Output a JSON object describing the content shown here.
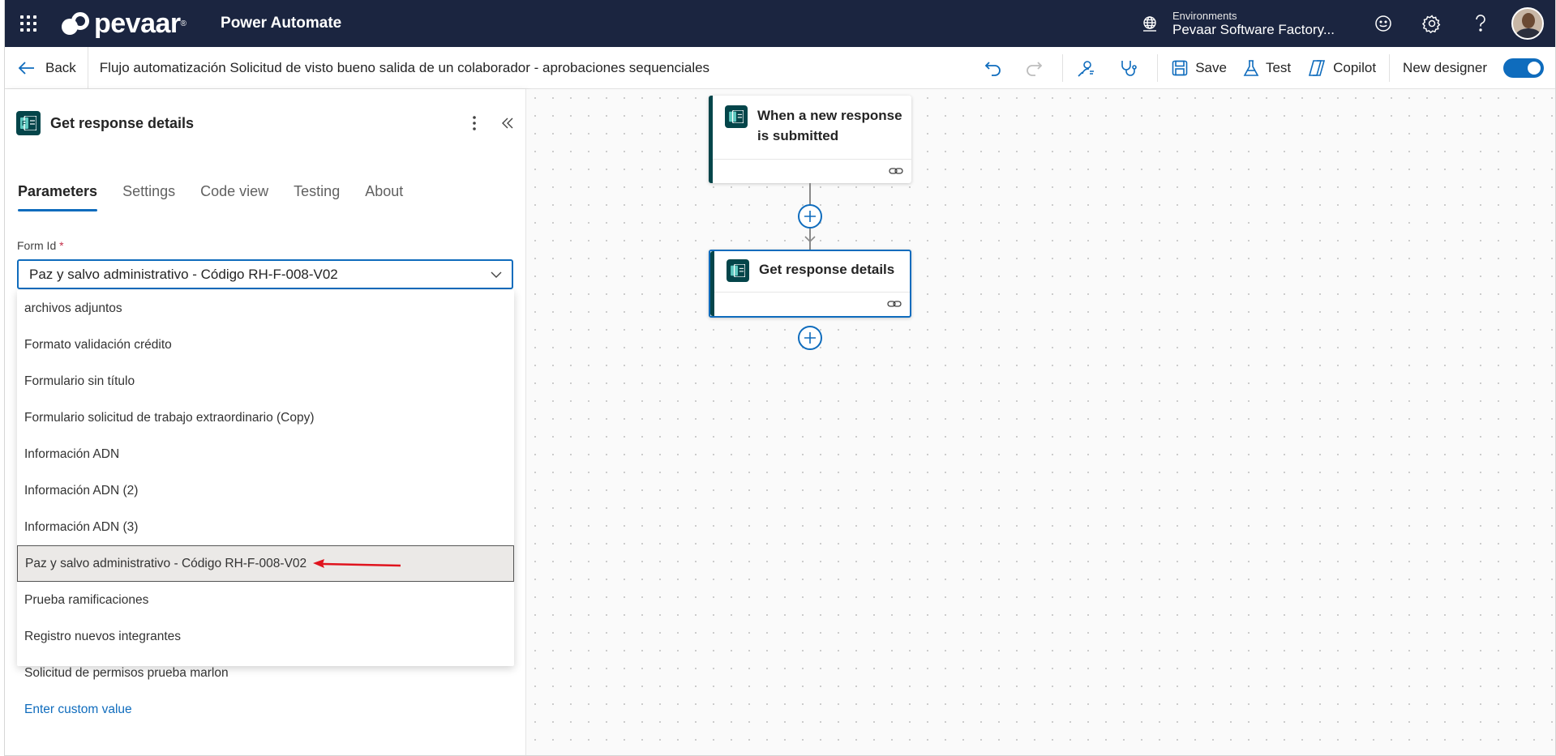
{
  "topbar": {
    "brand_name": "pevaar",
    "brand_reg": "®",
    "app_title": "Power Automate",
    "environment_label": "Environments",
    "environment_name": "Pevaar Software Factory..."
  },
  "cmdbar": {
    "back_label": "Back",
    "flow_title": "Flujo automatización Solicitud de visto bueno salida de un colaborador - aprobaciones sequenciales",
    "save_label": "Save",
    "test_label": "Test",
    "copilot_label": "Copilot",
    "new_designer_label": "New designer",
    "new_designer_on": true
  },
  "panel": {
    "title": "Get response details",
    "tabs": [
      {
        "label": "Parameters",
        "active": true
      },
      {
        "label": "Settings",
        "active": false
      },
      {
        "label": "Code view",
        "active": false
      },
      {
        "label": "Testing",
        "active": false
      },
      {
        "label": "About",
        "active": false
      }
    ],
    "field_label": "Form Id",
    "required_mark": "*",
    "field_value": "Paz y salvo administrativo - Código RH-F-008-V02",
    "options": [
      "archivos adjuntos",
      "Formato validación crédito",
      "Formulario sin título",
      "Formulario solicitud de trabajo extraordinario (Copy)",
      "Información ADN",
      "Información ADN (2)",
      "Información ADN (3)",
      "Paz y salvo administrativo - Código RH-F-008-V02",
      "Prueba ramificaciones",
      "Registro nuevos integrantes",
      "Solicitud de permisos prueba marlon"
    ],
    "selected_index": 7,
    "custom_value_label": "Enter custom value"
  },
  "canvas": {
    "trigger_title_line1": "When a new response",
    "trigger_title_line2": "is submitted",
    "action_title": "Get response details"
  },
  "colors": {
    "topbar_bg": "#1b2540",
    "accent": "#0f6cbd",
    "forms_green": "#04454a",
    "annotation_red": "#e0141e"
  }
}
